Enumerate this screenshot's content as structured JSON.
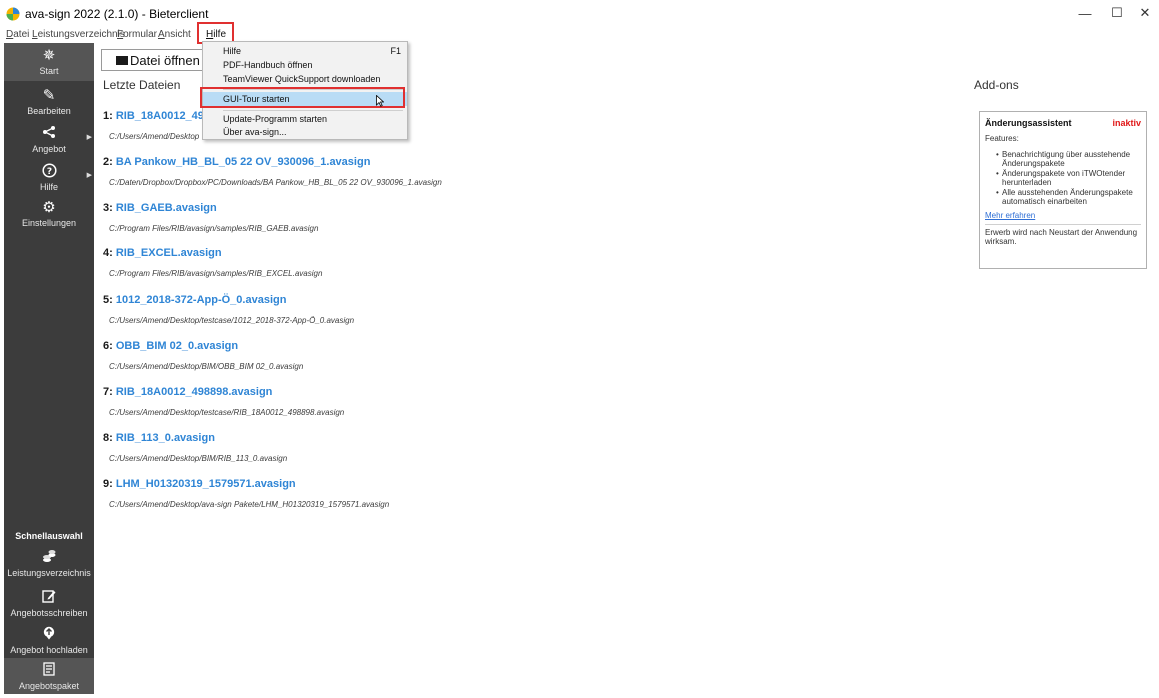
{
  "window": {
    "title": "ava-sign 2022 (2.1.0) - Bieterclient",
    "controls": [
      "—",
      "☐",
      "✕"
    ]
  },
  "menubar": {
    "items": [
      {
        "label": "Datei",
        "underline": "D",
        "rest": "atei"
      },
      {
        "label": "Leistungsverzeichnis",
        "underline": "L",
        "rest": "eistungsverzeichnis"
      },
      {
        "label": "Formular",
        "underline": "F",
        "rest": "ormular"
      },
      {
        "label": "Ansicht",
        "underline": "A",
        "rest": "nsicht"
      },
      {
        "label": "Hilfe",
        "underline": "H",
        "rest": "ilfe"
      }
    ]
  },
  "sidebar": {
    "items": [
      {
        "label": "Start",
        "icon": "start-icon"
      },
      {
        "label": "Bearbeiten",
        "icon": "pencil-icon"
      },
      {
        "label": "Angebot",
        "icon": "share-icon"
      },
      {
        "label": "Hilfe",
        "icon": "help-icon"
      },
      {
        "label": "Einstellungen",
        "icon": "gear-icon"
      }
    ],
    "quick_title": "Schnellauswahl",
    "quick_items": [
      {
        "label": "Leistungsverzeichnis",
        "icon": "coins-icon"
      },
      {
        "label": "Angebotsschreiben",
        "icon": "edit-document-icon"
      },
      {
        "label": "Angebot hochladen",
        "icon": "upload-icon"
      },
      {
        "label": "Angebotspaket",
        "icon": "package-icon"
      }
    ]
  },
  "main": {
    "open_button": "Datei öffnen",
    "recent_title": "Letzte Dateien",
    "files": [
      {
        "num": "1:",
        "name": "RIB_18A0012_4988",
        "path": "C:/Users/Amend/Desktop"
      },
      {
        "num": "2:",
        "name": "BA Pankow_HB_BL_05 22 OV_930096_1.avasign",
        "path": "C:/Daten/Dropbox/Dropbox/PC/Downloads/BA Pankow_HB_BL_05 22 OV_930096_1.avasign"
      },
      {
        "num": "3:",
        "name": "RIB_GAEB.avasign",
        "path": "C:/Program Files/RIB/avasign/samples/RIB_GAEB.avasign"
      },
      {
        "num": "4:",
        "name": "RIB_EXCEL.avasign",
        "path": "C:/Program Files/RIB/avasign/samples/RIB_EXCEL.avasign"
      },
      {
        "num": "5:",
        "name": "1012_2018-372-App-Ö_0.avasign",
        "path": "C:/Users/Amend/Desktop/testcase/1012_2018-372-App-Ö_0.avasign"
      },
      {
        "num": "6:",
        "name": "OBB_BIM 02_0.avasign",
        "path": "C:/Users/Amend/Desktop/BIM/OBB_BIM 02_0.avasign"
      },
      {
        "num": "7:",
        "name": "RIB_18A0012_498898.avasign",
        "path": "C:/Users/Amend/Desktop/testcase/RIB_18A0012_498898.avasign"
      },
      {
        "num": "8:",
        "name": "RIB_113_0.avasign",
        "path": "C:/Users/Amend/Desktop/BIM/RIB_113_0.avasign"
      },
      {
        "num": "9:",
        "name": "LHM_H01320319_1579571.avasign",
        "path": "C:/Users/Amend/Desktop/ava-sign Pakete/LHM_H01320319_1579571.avasign"
      }
    ]
  },
  "addons": {
    "title": "Add-ons",
    "card": {
      "name": "Änderungsassistent",
      "status": "inaktiv",
      "features_label": "Features:",
      "features": [
        "Benachrichtigung über ausstehende Änderungspakete",
        "Änderungspakete von iTWOtender herunterladen",
        "Alle ausstehenden Änderungspakete automatisch einarbeiten"
      ],
      "link": "Mehr erfahren",
      "note": "Erwerb wird nach Neustart der Anwendung wirksam."
    }
  },
  "dropdown": {
    "items": [
      {
        "label": "Hilfe",
        "shortcut": "F1"
      },
      {
        "label": "PDF-Handbuch öffnen",
        "shortcut": ""
      },
      {
        "label": "TeamViewer QuickSupport downloaden",
        "shortcut": ""
      },
      {
        "label": "GUI-Tour starten",
        "shortcut": ""
      },
      {
        "label": "Update-Programm starten",
        "shortcut": ""
      },
      {
        "label": "Über ava-sign...",
        "shortcut": ""
      }
    ]
  },
  "colors": {
    "sidebar_bg": "#3c3c3c",
    "link_blue": "#2f85d5",
    "status_red": "#e01818",
    "highlight_box": "#e03030",
    "menu_highlight": "#b9dcf5"
  }
}
